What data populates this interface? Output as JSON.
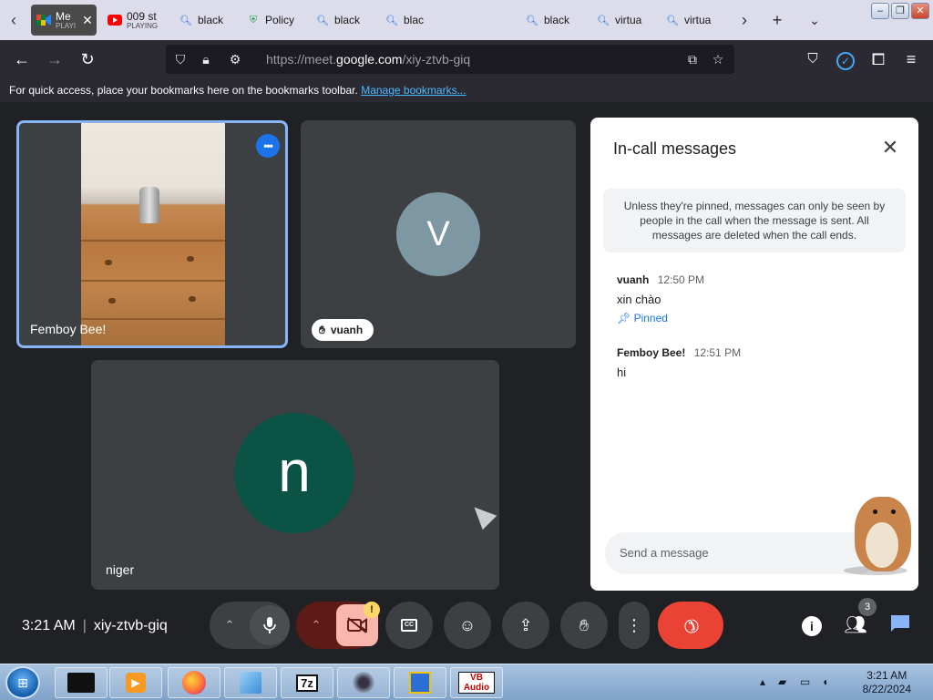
{
  "browser": {
    "tabs": [
      {
        "title": "Me",
        "sub": "PLAYI",
        "favicon": "google-meet-icon",
        "active": true
      },
      {
        "title": "009 st",
        "sub": "PLAYING",
        "favicon": "youtube-icon"
      },
      {
        "title": "black",
        "favicon": "search-icon"
      },
      {
        "title": "Policy",
        "favicon": "shield-icon"
      },
      {
        "title": "black",
        "favicon": "search-icon"
      },
      {
        "title": "blac",
        "favicon": "search-icon"
      },
      {
        "title": "black",
        "favicon": "search-icon"
      },
      {
        "title": "virtua",
        "favicon": "search-icon"
      },
      {
        "title": "virtua",
        "favicon": "search-icon"
      }
    ],
    "url_prefix": "https://meet.",
    "url_domain": "google.com",
    "url_path": "/xiy-ztvb-giq",
    "bookmarks_hint": "For quick access, place your bookmarks here on the bookmarks toolbar.",
    "bookmarks_link": "Manage bookmarks..."
  },
  "meet": {
    "tiles": {
      "self_name": "Femboy Bee!",
      "vuanh_initial": "V",
      "vuanh_name": "vuanh",
      "niger_initial": "n",
      "niger_name": "niger"
    },
    "chat": {
      "title": "In-call messages",
      "notice": "Unless they're pinned, messages can only be seen by people in the call when the message is sent. All messages are deleted when the call ends.",
      "messages": [
        {
          "sender": "vuanh",
          "time": "12:50 PM",
          "text": "xin chào",
          "pinned_label": "Pinned"
        },
        {
          "sender": "Femboy Bee!",
          "time": "12:51 PM",
          "text": "hi"
        }
      ],
      "input_placeholder": "Send a message"
    },
    "controls": {
      "time": "3:21 AM",
      "meeting_code": "xiy-ztvb-giq",
      "camera_warning": "!",
      "people_count": "3"
    }
  },
  "taskbar": {
    "apps": [
      "black-box-icon",
      "media-player-icon",
      "firefox-icon",
      "notepad-icon",
      "7z",
      "webcam-icon",
      "floppy-icon",
      "VB Audio"
    ],
    "clock_time": "3:21 AM",
    "clock_date": "8/22/2024"
  },
  "colors": {
    "meet_bg": "#202124",
    "tile_bg": "#3c4043",
    "self_border": "#8ab4f8",
    "avatar_v": "#7d97a3",
    "avatar_n": "#0b5345",
    "end_call": "#ea4335",
    "pinned_link": "#1a73e8"
  }
}
